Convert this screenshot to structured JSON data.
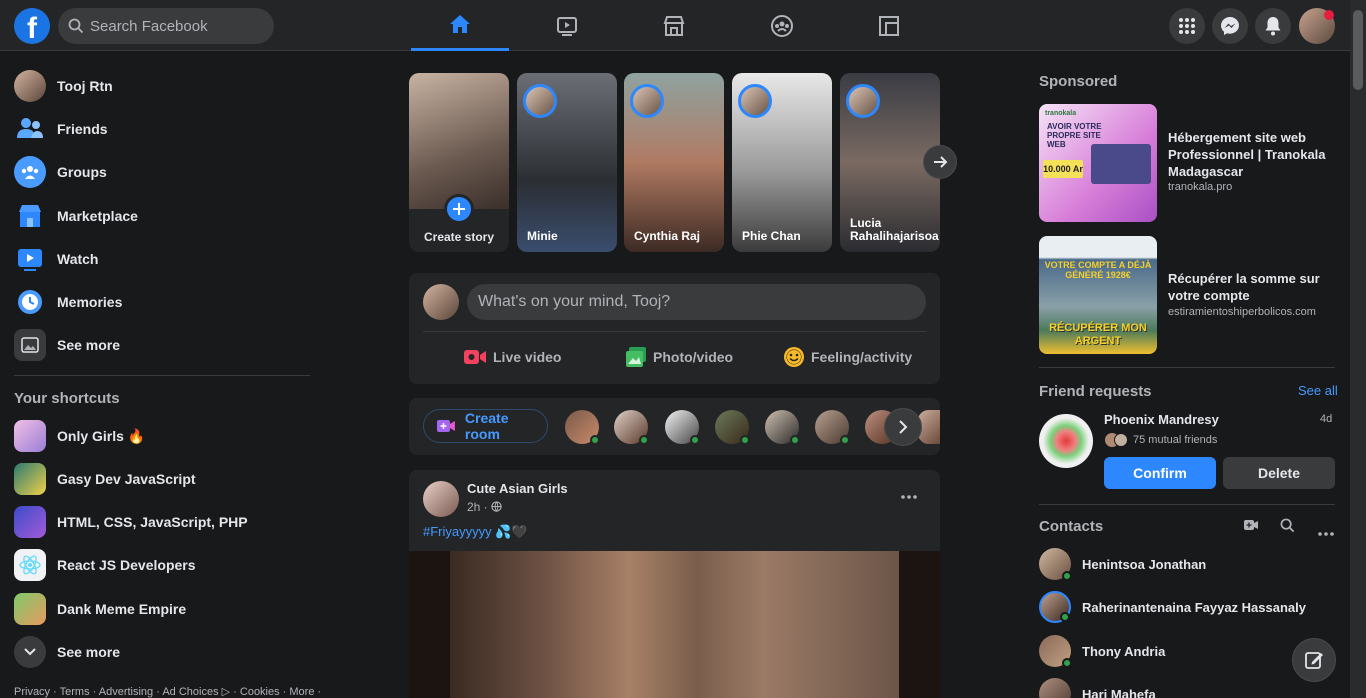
{
  "search": {
    "placeholder": "Search Facebook"
  },
  "top_nav": [
    {
      "name": "home-tab",
      "icon": "home-icon"
    },
    {
      "name": "watch-tab",
      "icon": "video-icon"
    },
    {
      "name": "marketplace-tab",
      "icon": "store-icon"
    },
    {
      "name": "groups-tab",
      "icon": "groups-icon"
    },
    {
      "name": "gaming-tab",
      "icon": "gaming-icon"
    }
  ],
  "sidebar": {
    "profile": "Tooj Rtn",
    "items": [
      {
        "label": "Friends",
        "icon": "friends-icon"
      },
      {
        "label": "Groups",
        "icon": "groups-icon"
      },
      {
        "label": "Marketplace",
        "icon": "marketplace-icon"
      },
      {
        "label": "Watch",
        "icon": "watch-icon"
      },
      {
        "label": "Memories",
        "icon": "memories-icon"
      },
      {
        "label": "See more",
        "icon": "see-more-icon"
      }
    ],
    "shortcuts_title": "Your shortcuts",
    "shortcuts": [
      {
        "label": "Only Girls 🔥"
      },
      {
        "label": "Gasy Dev JavaScript"
      },
      {
        "label": "HTML, CSS, JavaScript, PHP"
      },
      {
        "label": "React JS Developers"
      },
      {
        "label": "Dank Meme Empire"
      },
      {
        "label": "See more"
      }
    ],
    "footer": "Privacy · Terms · Advertising · Ad Choices ▷ · Cookies · More ·"
  },
  "stories": {
    "create_label": "Create story",
    "items": [
      {
        "name": "Minie"
      },
      {
        "name": "Cynthia Raj"
      },
      {
        "name": "Phie Chan"
      },
      {
        "name": "Lucia Rahalihajarisoa"
      }
    ]
  },
  "composer": {
    "placeholder": "What's on your mind, Tooj?",
    "live_video": "Live video",
    "photo_video": "Photo/video",
    "feeling": "Feeling/activity"
  },
  "rooms": {
    "create_label": "Create room"
  },
  "post": {
    "author": "Cute Asian Girls",
    "time": "2h ·",
    "text": "#Friyayyyyy 💦🖤"
  },
  "right": {
    "sponsored_title": "Sponsored",
    "ads": [
      {
        "title": "Hébergement site web Professionnel | Tranokala Madagascar",
        "url": "tranokala.pro",
        "img_top": "AVOIR VOTRE PROPRE SITE WEB",
        "img_price": "10.000 Ar",
        "brand": "tranokala"
      },
      {
        "title": "Récupérer la somme sur votre compte",
        "url": "estiramientoshiperbolicos.com",
        "img_top": "VOTRE COMPTE A DÉJÀ GÉNÉRÉ 1928€",
        "img_bottom": "RÉCUPÉRER MON ARGENT"
      }
    ],
    "friend_requests_title": "Friend requests",
    "see_all": "See all",
    "request": {
      "name": "Phoenix Mandresy",
      "age": "4d",
      "mutual": "75 mutual friends",
      "confirm": "Confirm",
      "delete": "Delete"
    },
    "contacts_title": "Contacts",
    "contacts": [
      {
        "name": "Henintsoa Jonathan"
      },
      {
        "name": "Raherinantenaina Fayyaz Hassanaly"
      },
      {
        "name": "Thony Andria"
      },
      {
        "name": "Hari Mahefa"
      }
    ]
  },
  "colors": {
    "accent": "#2d88ff",
    "background": "#18191a",
    "surface": "#242526",
    "online": "#31a24c"
  }
}
